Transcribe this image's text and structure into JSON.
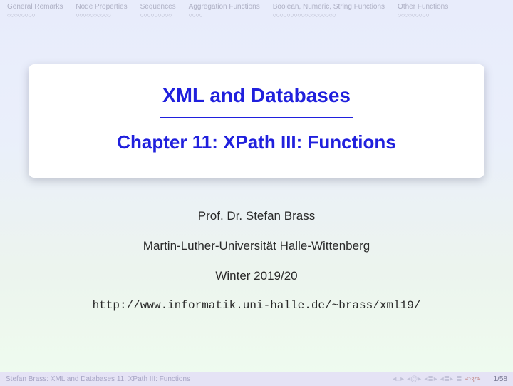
{
  "nav": [
    {
      "title": "General Remarks",
      "dots": "○○○○○○○○"
    },
    {
      "title": "Node Properties",
      "dots": "○○○○○○○○○○"
    },
    {
      "title": "Sequences",
      "dots": "○○○○○○○○○"
    },
    {
      "title": "Aggregation Functions",
      "dots": "○○○○"
    },
    {
      "title": "Boolean, Numeric, String Functions",
      "dots": "○○○○○○○○○○○○○○○○○○"
    },
    {
      "title": "Other Functions",
      "dots": "○○○○○○○○○"
    }
  ],
  "card": {
    "title": "XML and Databases",
    "subtitle": "Chapter 11: XPath III: Functions"
  },
  "meta": {
    "author": "Prof. Dr. Stefan Brass",
    "institution": "Martin-Luther-Universität Halle-Wittenberg",
    "term": "Winter 2019/20"
  },
  "url": "http://www.informatik.uni-halle.de/~brass/xml19/",
  "footer": {
    "left": "Stefan Brass:   XML and Databases  11. XPath III: Functions",
    "page": "1/58"
  }
}
